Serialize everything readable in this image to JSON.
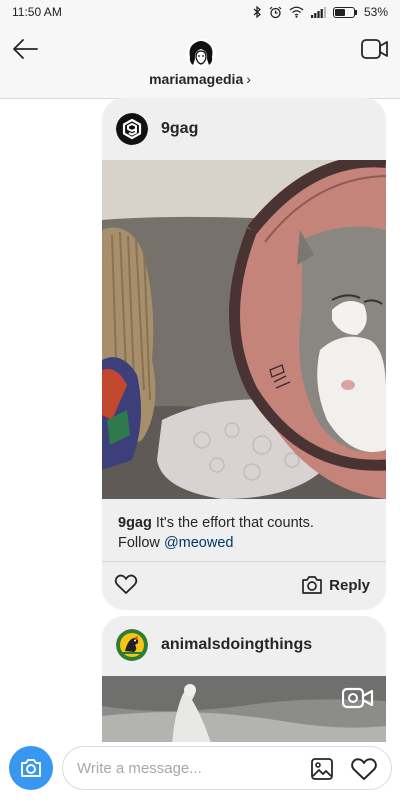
{
  "status_bar": {
    "time": "11:50 AM",
    "battery": "53%",
    "battery_level": 0.53
  },
  "header": {
    "username": "mariamagedia",
    "chevron": "›",
    "icons": [
      "back-arrow-icon",
      "video-call-icon"
    ]
  },
  "posts": [
    {
      "account": "9gag",
      "caption_user": "9gag",
      "caption_text": " It's the effort that counts.",
      "caption_line2_prefix": "Follow ",
      "mention": "@meowed",
      "reply_label": "Reply",
      "image": "cat wearing a cone collar on a couch"
    },
    {
      "account": "animalsdoingthings",
      "image": "dog in snow video thumbnail",
      "media_type": "video"
    }
  ],
  "composer": {
    "placeholder": "Write a message...",
    "camera_color": "#3897f0"
  }
}
